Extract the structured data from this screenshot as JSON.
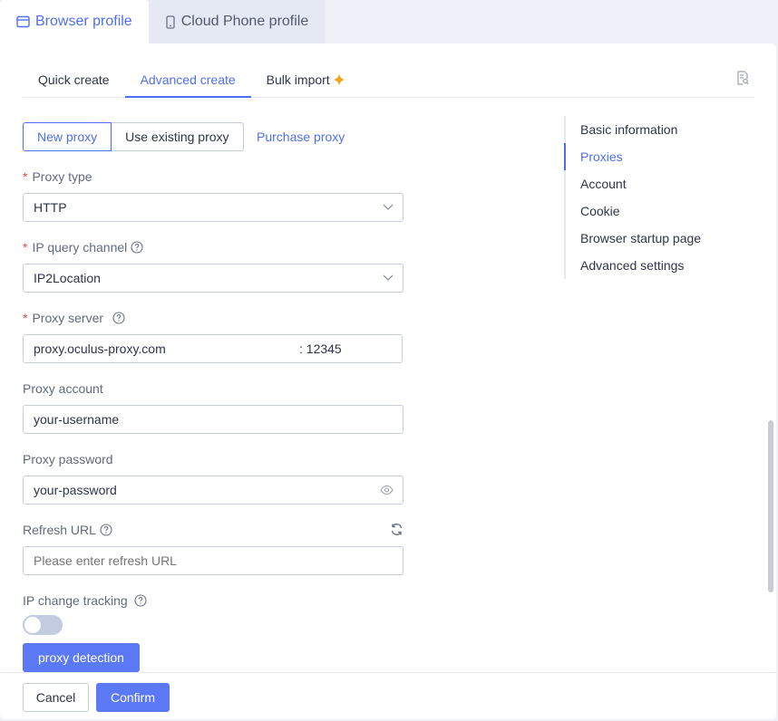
{
  "top_tabs": {
    "browser_profile": "Browser profile",
    "cloud_phone_profile": "Cloud Phone profile"
  },
  "sub_tabs": {
    "quick_create": "Quick create",
    "advanced_create": "Advanced create",
    "bulk_import": "Bulk import"
  },
  "proxy_mode": {
    "new_proxy": "New proxy",
    "use_existing_proxy": "Use existing proxy",
    "purchase_proxy": "Purchase proxy"
  },
  "form": {
    "proxy_type": {
      "label": "Proxy type",
      "value": "HTTP"
    },
    "ip_query_channel": {
      "label": "IP query channel",
      "value": "IP2Location"
    },
    "proxy_server": {
      "label": "Proxy server",
      "host": "proxy.oculus-proxy.com",
      "port": ": 12345"
    },
    "proxy_account": {
      "label": "Proxy account",
      "value": "your-username"
    },
    "proxy_password": {
      "label": "Proxy password",
      "value": "your-password"
    },
    "refresh_url": {
      "label": "Refresh URL",
      "placeholder": "Please enter refresh URL"
    },
    "ip_change_tracking": {
      "label": "IP change tracking",
      "enabled": false
    },
    "proxy_detection": "proxy detection"
  },
  "anchor_nav": {
    "items": [
      {
        "label": "Basic information",
        "active": false
      },
      {
        "label": "Proxies",
        "active": true
      },
      {
        "label": "Account",
        "active": false
      },
      {
        "label": "Cookie",
        "active": false
      },
      {
        "label": "Browser startup page",
        "active": false
      },
      {
        "label": "Advanced settings",
        "active": false
      }
    ]
  },
  "footer": {
    "cancel": "Cancel",
    "confirm": "Confirm"
  },
  "colors": {
    "accent": "#4f6ff2",
    "primary_button": "#5b78f5",
    "required": "#e84646",
    "star": "#f5a623"
  }
}
